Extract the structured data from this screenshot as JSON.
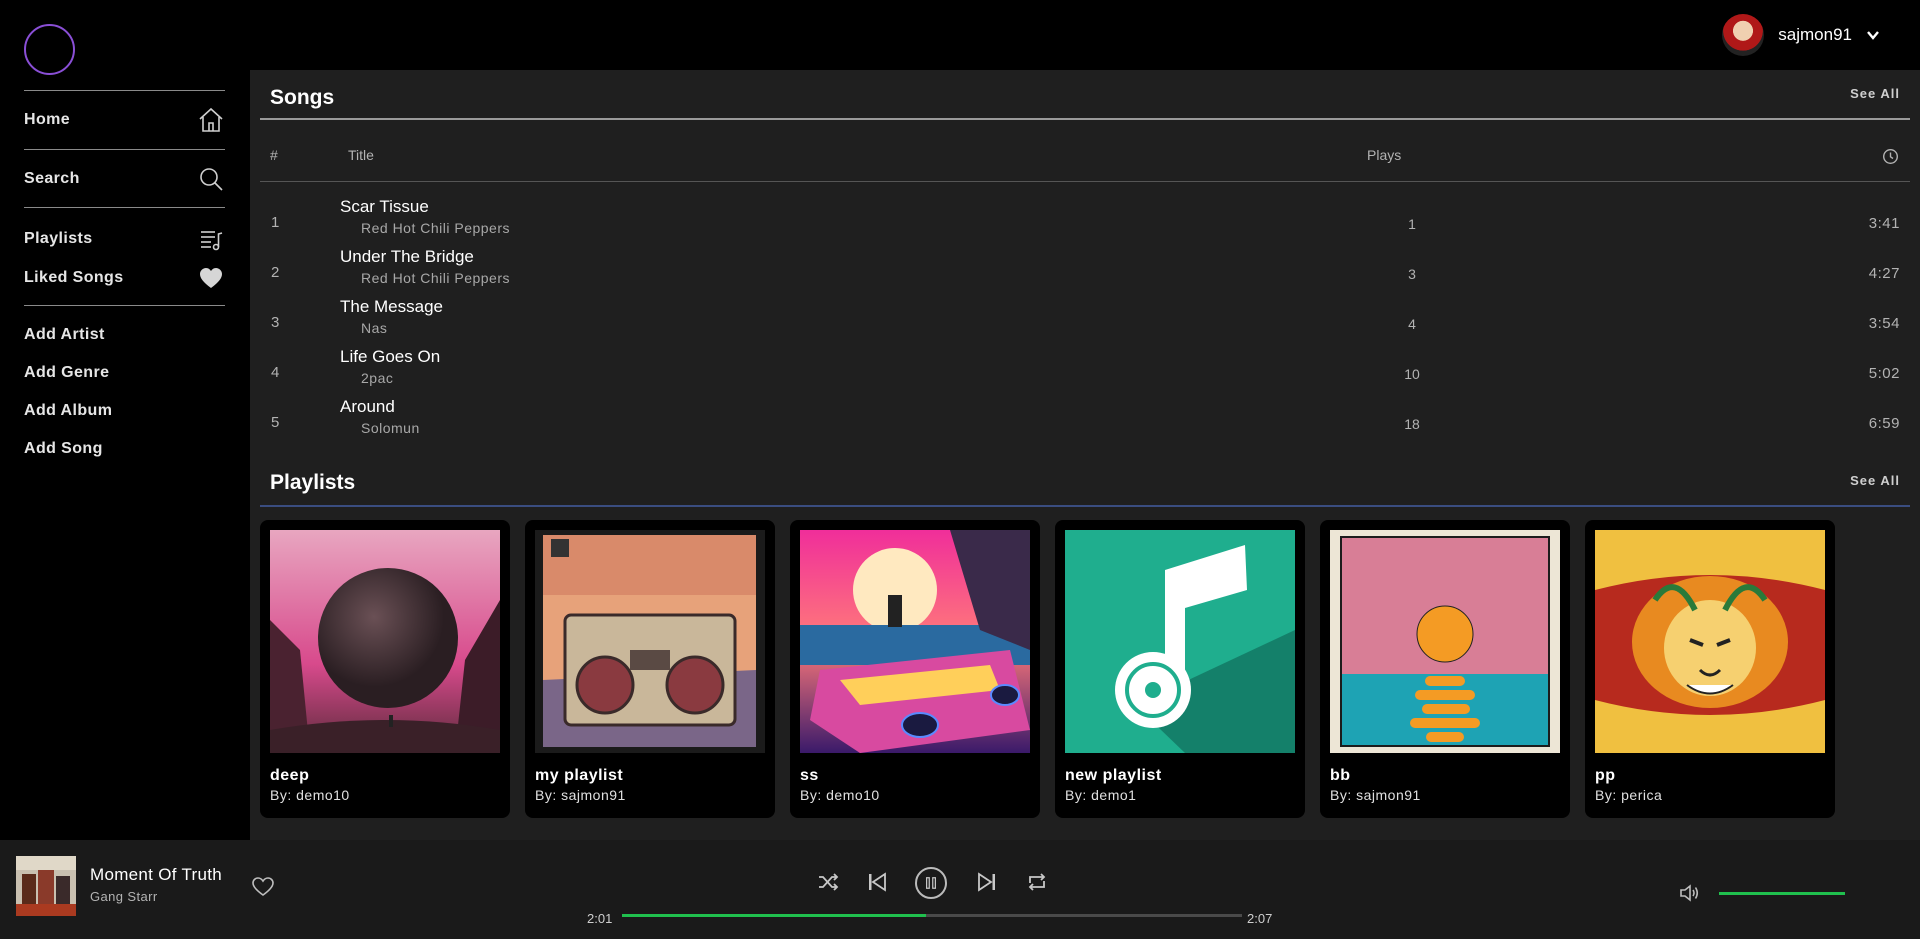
{
  "colors": {
    "accent": "#20c04e",
    "songs_rule": "#9a9a9a",
    "playlists_rule": "#3a4d80",
    "logo_ring": "#8a4fd6"
  },
  "user": {
    "name": "sajmon91"
  },
  "sidebar": {
    "primary": [
      {
        "label": "Home",
        "icon": "home-icon"
      },
      {
        "label": "Search",
        "icon": "search-icon"
      }
    ],
    "library": [
      {
        "label": "Playlists",
        "icon": "playlist-icon"
      },
      {
        "label": "Liked Songs",
        "icon": "heart-icon"
      }
    ],
    "admin": [
      {
        "label": "Add Artist"
      },
      {
        "label": "Add Genre"
      },
      {
        "label": "Add Album"
      },
      {
        "label": "Add Song"
      }
    ]
  },
  "songs": {
    "title": "Songs",
    "see_all": "See All",
    "columns": {
      "num": "#",
      "title": "Title",
      "plays": "Plays",
      "duration_icon": "clock-icon"
    },
    "rows": [
      {
        "num": "1",
        "title": "Scar Tissue",
        "artist": "Red Hot Chili Peppers",
        "plays": "1",
        "duration": "3:41"
      },
      {
        "num": "2",
        "title": "Under The Bridge",
        "artist": "Red Hot Chili Peppers",
        "plays": "3",
        "duration": "4:27"
      },
      {
        "num": "3",
        "title": "The Message",
        "artist": "Nas",
        "plays": "4",
        "duration": "3:54"
      },
      {
        "num": "4",
        "title": "Life Goes On",
        "artist": "2pac",
        "plays": "10",
        "duration": "5:02"
      },
      {
        "num": "5",
        "title": "Around",
        "artist": "Solomun",
        "plays": "18",
        "duration": "6:59"
      }
    ]
  },
  "playlists": {
    "title": "Playlists",
    "see_all": "See All",
    "items": [
      {
        "name": "deep",
        "by": "By: demo10"
      },
      {
        "name": "my playlist",
        "by": "By: sajmon91"
      },
      {
        "name": "ss",
        "by": "By: demo10"
      },
      {
        "name": "new playlist",
        "by": "By: demo1"
      },
      {
        "name": "bb",
        "by": "By: sajmon91"
      },
      {
        "name": "pp",
        "by": "By: perica"
      }
    ]
  },
  "player": {
    "title": "Moment Of Truth",
    "artist": "Gang Starr",
    "elapsed": "2:01",
    "total": "2:07",
    "progress": 0.49,
    "volume": 1.0
  }
}
